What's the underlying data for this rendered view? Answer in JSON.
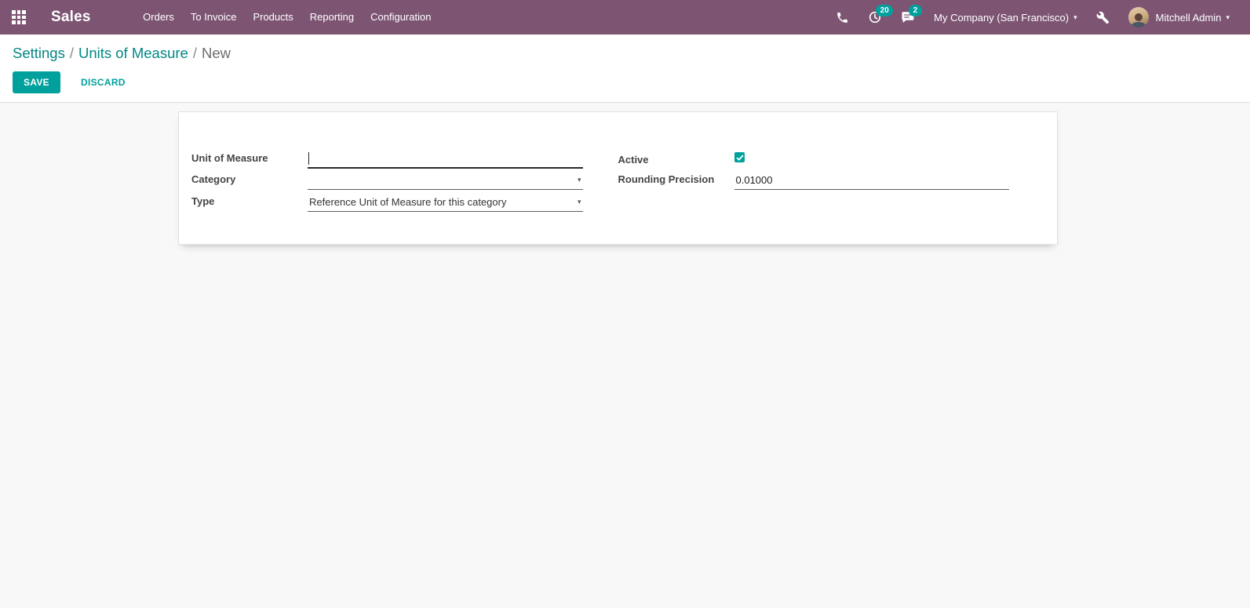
{
  "navbar": {
    "app": "Sales",
    "menu": [
      "Orders",
      "To Invoice",
      "Products",
      "Reporting",
      "Configuration"
    ],
    "activity_badge": "20",
    "message_badge": "2",
    "company": "My Company (San Francisco)",
    "user": "Mitchell Admin"
  },
  "breadcrumb": {
    "links": [
      "Settings",
      "Units of Measure"
    ],
    "current": "New",
    "separator": "/"
  },
  "toolbar": {
    "save": "SAVE",
    "discard": "DISCARD"
  },
  "form": {
    "unit_of_measure": {
      "label": "Unit of Measure",
      "value": "",
      "placeholder": ""
    },
    "category": {
      "label": "Category",
      "value": ""
    },
    "type": {
      "label": "Type",
      "value": "Reference Unit of Measure for this category"
    },
    "active": {
      "label": "Active",
      "checked": true
    },
    "rounding_precision": {
      "label": "Rounding Precision",
      "value": "0.01000"
    }
  },
  "icons": {
    "caret": "▾"
  },
  "colors": {
    "navbar": "#7d5573",
    "accent": "#00A09D",
    "link": "#008784"
  }
}
